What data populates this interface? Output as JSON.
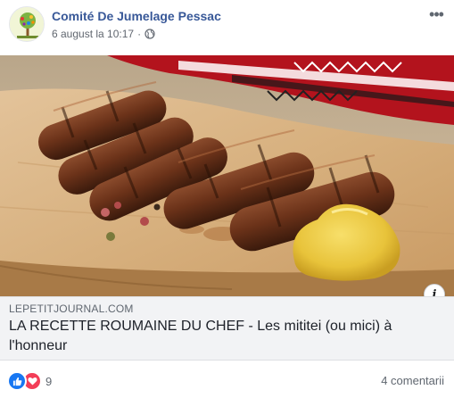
{
  "post": {
    "page_name": "Comité De Jumelage Pessac",
    "timestamp": "6 august la 10:17",
    "separator": "·",
    "audience_icon": "globe-icon",
    "more_label": "•••"
  },
  "link": {
    "domain": "LEPETITJOURNAL.COM",
    "headline": "LA RECETTE ROUMAINE DU CHEF - Les mititei (ou mici) à l'honneur",
    "info_label": "i"
  },
  "footer": {
    "reaction_icons": [
      "like-icon",
      "love-icon"
    ],
    "reaction_count": "9",
    "comments": "4 comentarii"
  },
  "colors": {
    "link_blue": "#385898",
    "like_blue": "#1877f2",
    "love_red": "#f33e58",
    "meta_gray": "#616770"
  }
}
